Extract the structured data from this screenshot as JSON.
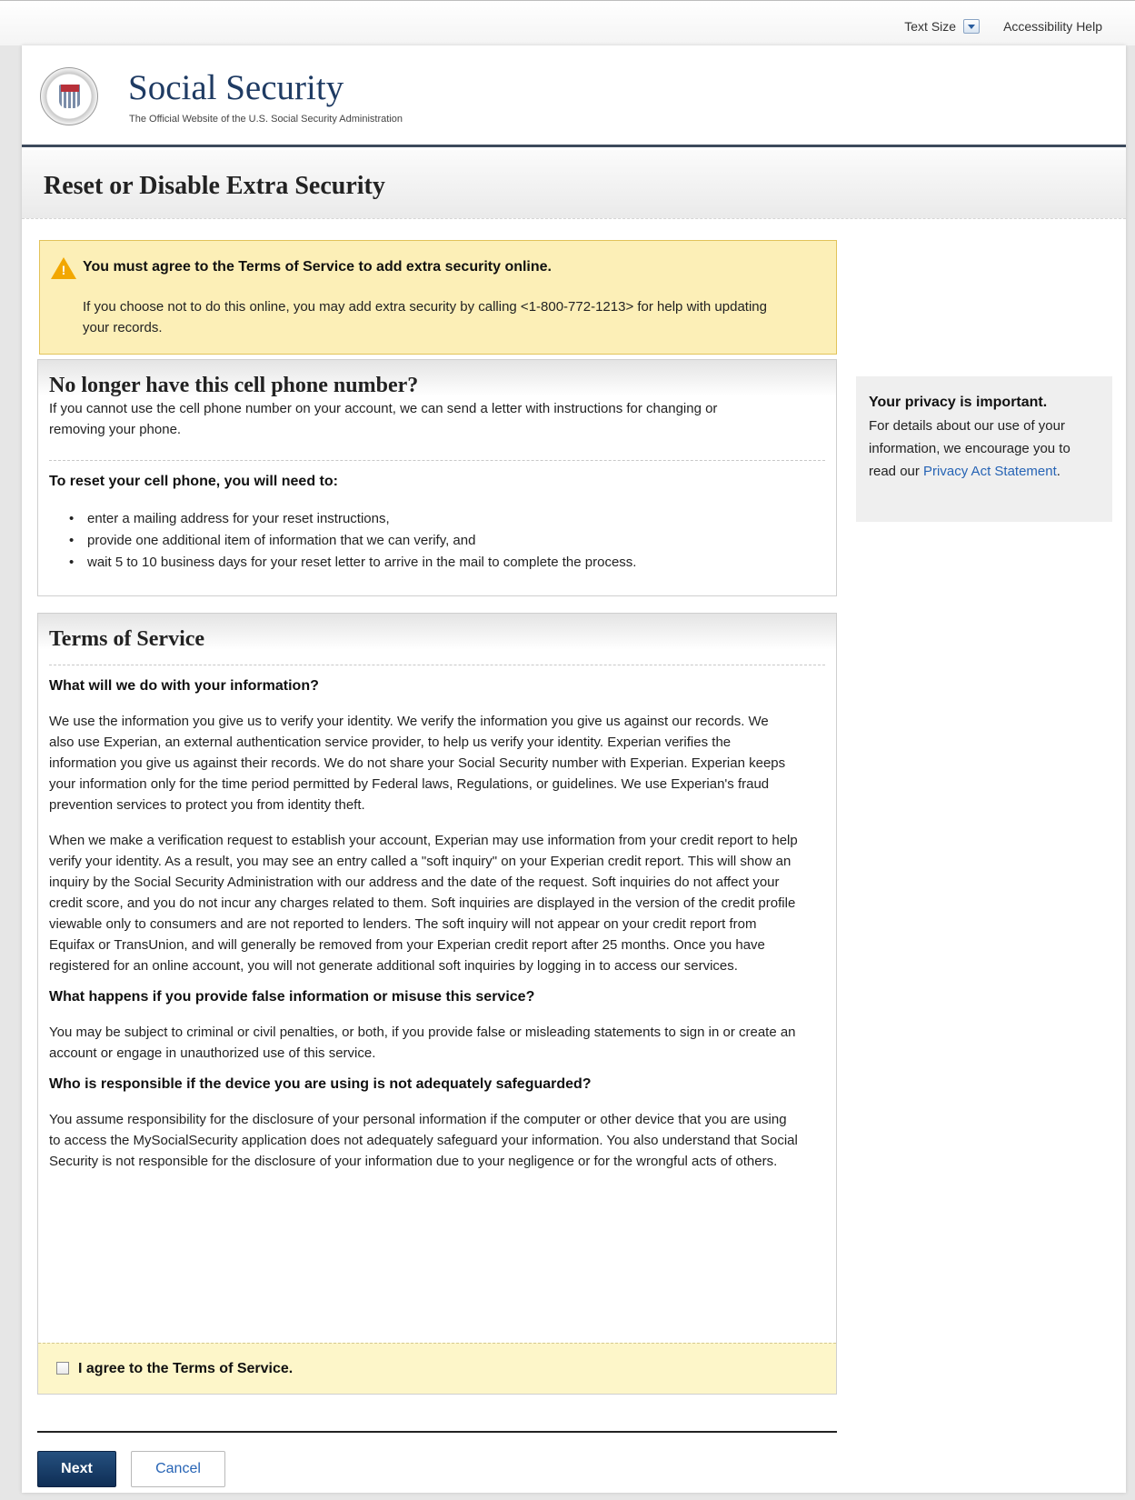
{
  "topbar": {
    "text_size_label": "Text Size",
    "accessibility_label": "Accessibility Help"
  },
  "masthead": {
    "title": "Social Security",
    "subtitle": "The Official Website of the U.S. Social Security Administration",
    "seal_text": "USA"
  },
  "page": {
    "title": "Reset or Disable Extra Security"
  },
  "alert": {
    "title": "You must agree to the Terms of Service to add extra security online.",
    "body": "If you choose not to do this online, you may add extra security by calling <1-800-772-1213> for help with updating your records."
  },
  "phone_panel": {
    "heading": "No longer have this cell phone number?",
    "intro": "If you cannot use the cell phone number on your account, we can send a letter with instructions for changing or removing your phone.",
    "subheading": "To reset your cell phone, you will need to:",
    "items": [
      "enter a mailing address for your reset instructions,",
      "provide one additional item of information that we can verify, and",
      "wait 5 to 10 business days for your reset letter to arrive in the mail to complete the process."
    ]
  },
  "terms_panel": {
    "heading": "Terms of Service",
    "q1": "What will we do with your information?",
    "p1": "We use the information you give us to verify your identity. We verify the information you give us against our records. We also use Experian, an external authentication service provider, to help us verify your identity. Experian verifies the information you give us against their records. We do not share your Social Security number with Experian. Experian keeps your information only for the time period permitted by Federal laws, Regulations, or guidelines. We use Experian's fraud prevention services to protect you from identity theft.",
    "p2": "When we make a verification request to establish your account, Experian may use information from your credit report to help verify your identity. As a result, you may see an entry called a \"soft inquiry\" on your Experian credit report. This will show an inquiry by the Social Security Administration with our address and the date of the request. Soft inquiries do not affect your credit score, and you do not incur any charges related to them. Soft inquiries are displayed in the version of the credit profile viewable only to consumers and are not reported to lenders. The soft inquiry will not appear on your credit report from Equifax or TransUnion, and will generally be removed from your Experian credit report after 25 months. Once you have registered for an online account, you will not generate additional soft inquiries by logging in to access our services.",
    "q2": "What happens if you provide false information or misuse this service?",
    "p3": "You may be subject to criminal or civil penalties, or both, if you provide false or misleading statements to sign in or create an account or engage in unauthorized use of this service.",
    "q3": "Who is responsible if the device you are using is not adequately safeguarded?",
    "p4": "You assume responsibility for the disclosure of your personal information if the computer or other device that you are using to access the MySocialSecurity application does not adequately safeguard your information. You also understand that Social Security is not responsible for the disclosure of your information due to your negligence or for the wrongful acts of others.",
    "agree_label": "I agree to the Terms of Service.",
    "agree_checked": false
  },
  "privacy": {
    "heading": "Your privacy is important.",
    "text": "For details about our use of your information, we encourage you to read our",
    "link": "Privacy Act Statement",
    "suffix": "."
  },
  "buttons": {
    "next": "Next",
    "cancel": "Cancel"
  },
  "colors": {
    "brand_navy": "#1f3b63",
    "alert_bg": "#fcefb7",
    "link": "#2764b5",
    "next_button": "#1a3d68"
  }
}
